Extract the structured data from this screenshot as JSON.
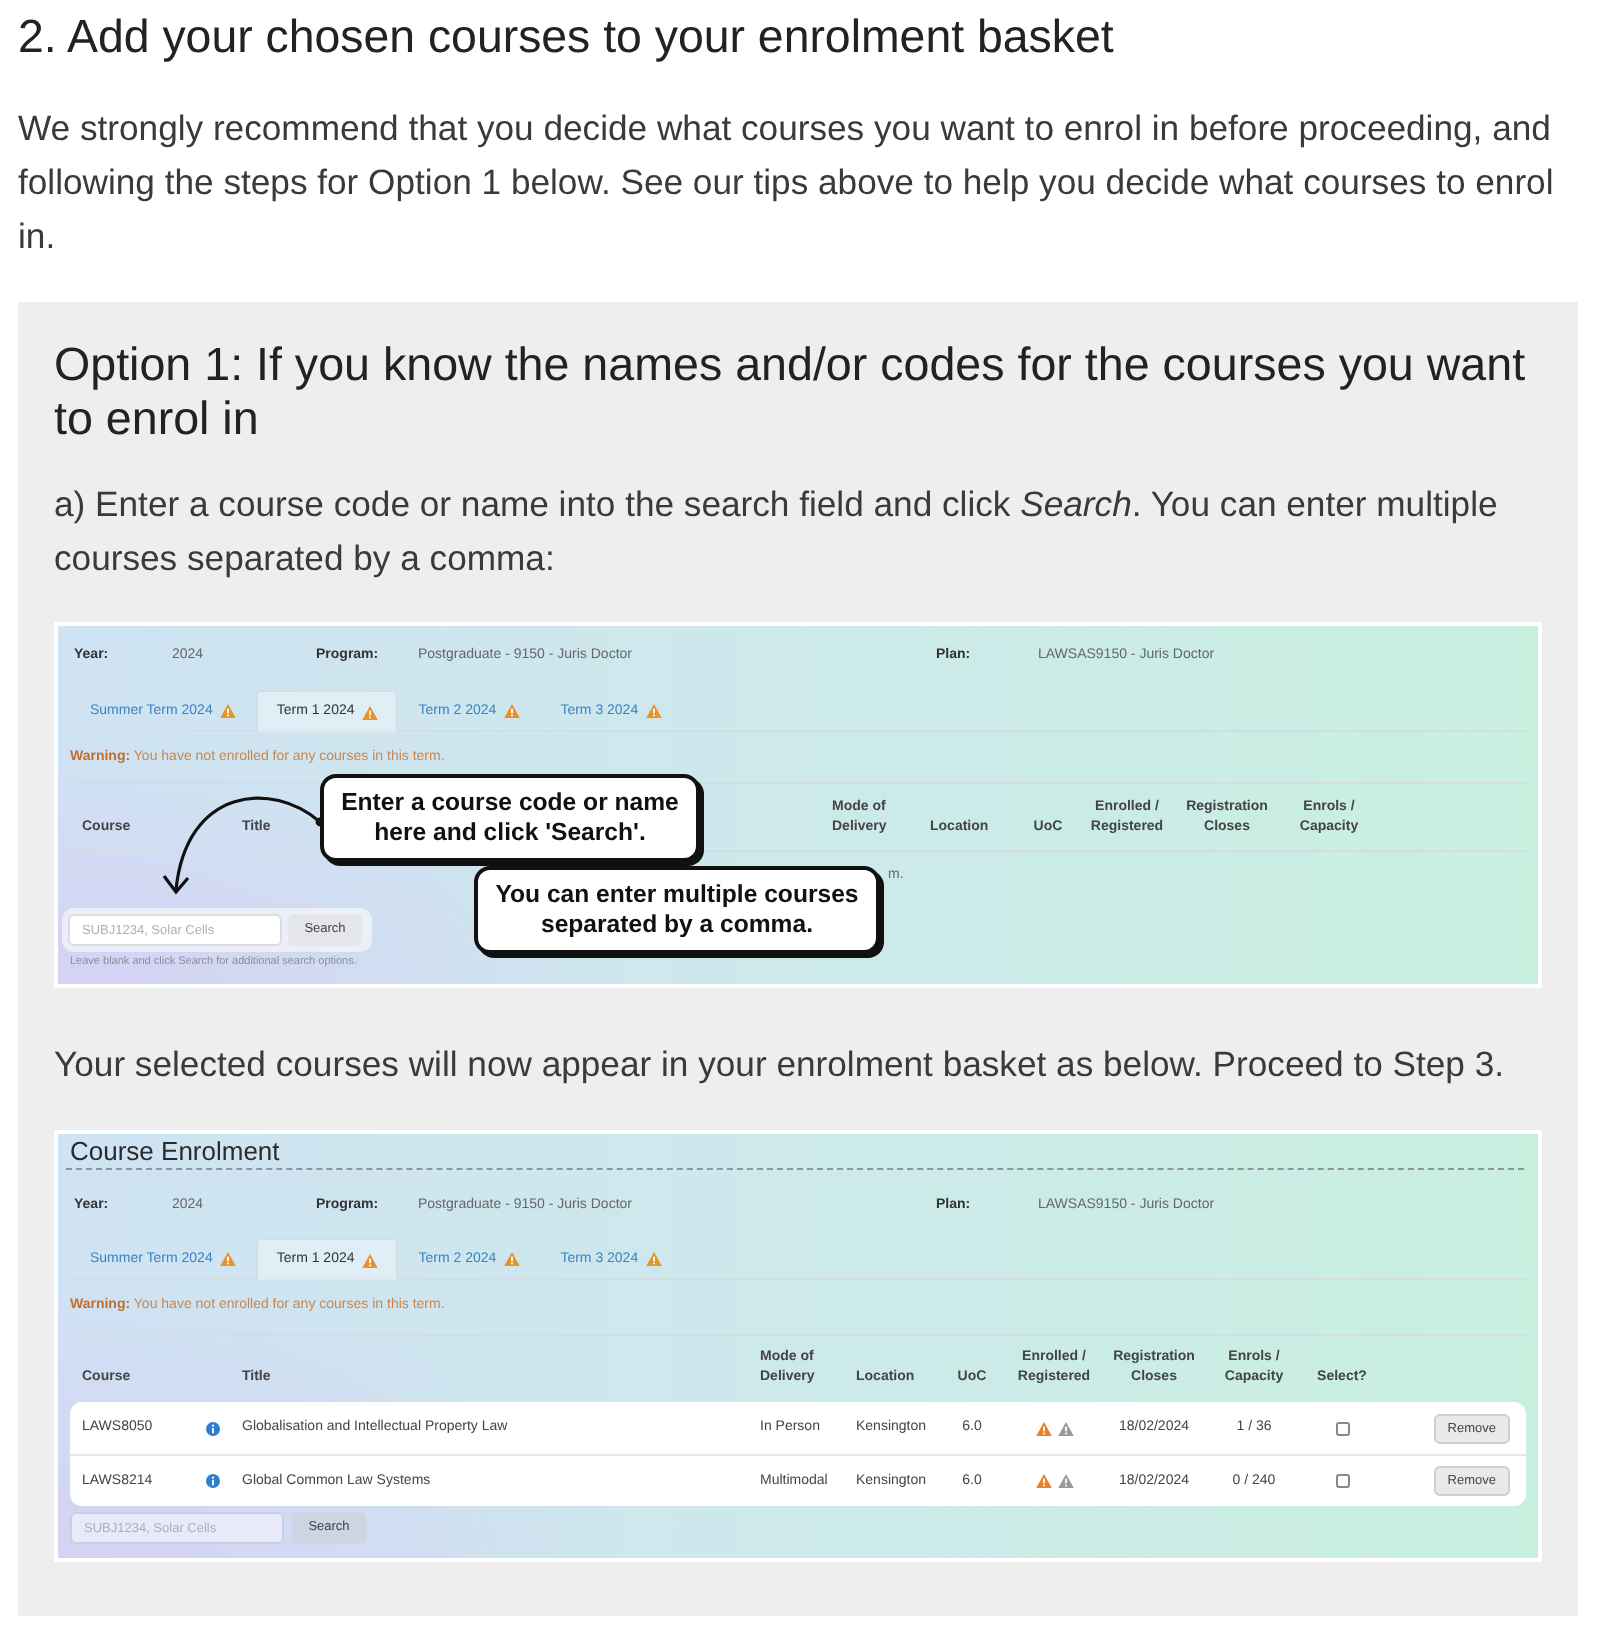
{
  "heading": "2. Add your chosen courses to your enrolment basket",
  "intro": "We strongly recommend that you decide what courses you want to enrol in before proceeding, and following the steps for Option 1 below. See our tips above to help you decide what courses to enrol in.",
  "option": {
    "title": "Option 1: If you know the names and/or codes for the courses you want to enrol in",
    "blocks": [
      {
        "kind": "text",
        "text": "a) Enter a course code or name into the search field and click *Search*. You can enter multiple courses separated by a comma:"
      },
      {
        "kind": "screenshot",
        "info": [
          {
            "label": "Year:",
            "value": "2024"
          },
          {
            "label": "Program:",
            "value": "Postgraduate - 9150 - Juris Doctor"
          },
          {
            "label": "Plan:",
            "value": "LAWSAS9150 - Juris Doctor"
          }
        ],
        "tabs": [
          {
            "label": "Summer Term 2024",
            "selected": false,
            "warning": true
          },
          {
            "label": "Term 1 2024",
            "selected": true,
            "warning": true
          },
          {
            "label": "Term 2 2024",
            "selected": false,
            "warning": true
          },
          {
            "label": "Term 3 2024",
            "selected": false,
            "warning": true
          }
        ],
        "warning": {
          "label": "Warning:",
          "text": "You have not enrolled for any courses in this term."
        },
        "columns": [
          "Course",
          "Title",
          "Mode of Delivery",
          "Location",
          "UoC",
          "Enrolled / Registered",
          "Registration Closes",
          "Enrols / Capacity"
        ],
        "table_message": "m.",
        "search": {
          "placeholder": "SUBJ1234, Solar Cells",
          "button": "Search",
          "highlighted": true,
          "hint": "Leave blank and click Search for additional search options."
        },
        "callouts": [
          {
            "lines": [
              "Enter a course code or name",
              "here and click 'Search'."
            ]
          },
          {
            "lines": [
              "You can enter multiple courses",
              "separated by a comma."
            ]
          }
        ]
      },
      {
        "kind": "text",
        "text": "Your selected courses will now appear in your enrolment basket as below. Proceed to Step 3."
      },
      {
        "kind": "screenshot",
        "title": "Course Enrolment",
        "info": [
          {
            "label": "Year:",
            "value": "2024"
          },
          {
            "label": "Program:",
            "value": "Postgraduate - 9150 - Juris Doctor"
          },
          {
            "label": "Plan:",
            "value": "LAWSAS9150 - Juris Doctor"
          }
        ],
        "tabs": [
          {
            "label": "Summer Term 2024",
            "selected": false,
            "warning": true
          },
          {
            "label": "Term 1 2024",
            "selected": true,
            "warning": true
          },
          {
            "label": "Term 2 2024",
            "selected": false,
            "warning": true
          },
          {
            "label": "Term 3 2024",
            "selected": false,
            "warning": true
          }
        ],
        "warning": {
          "label": "Warning:",
          "text": "You have not enrolled for any courses in this term."
        },
        "columns": [
          "Course",
          "Title",
          "Mode of Delivery",
          "Location",
          "UoC",
          "Enrolled / Registered",
          "Registration Closes",
          "Enrols / Capacity",
          "Select?"
        ],
        "rows": [
          {
            "course": "LAWS8050",
            "title": "Globalisation and Intellectual Property Law",
            "mode": "In Person",
            "location": "Kensington",
            "uoc": "6.0",
            "closes": "18/02/2024",
            "enrols": "1 / 36",
            "selected": false,
            "action": "Remove"
          },
          {
            "course": "LAWS8214",
            "title": "Global Common Law Systems",
            "mode": "Multimodal",
            "location": "Kensington",
            "uoc": "6.0",
            "closes": "18/02/2024",
            "enrols": "0 / 240",
            "selected": false,
            "action": "Remove"
          }
        ],
        "search": {
          "placeholder": "SUBJ1234, Solar Cells",
          "button": "Search"
        }
      }
    ]
  }
}
